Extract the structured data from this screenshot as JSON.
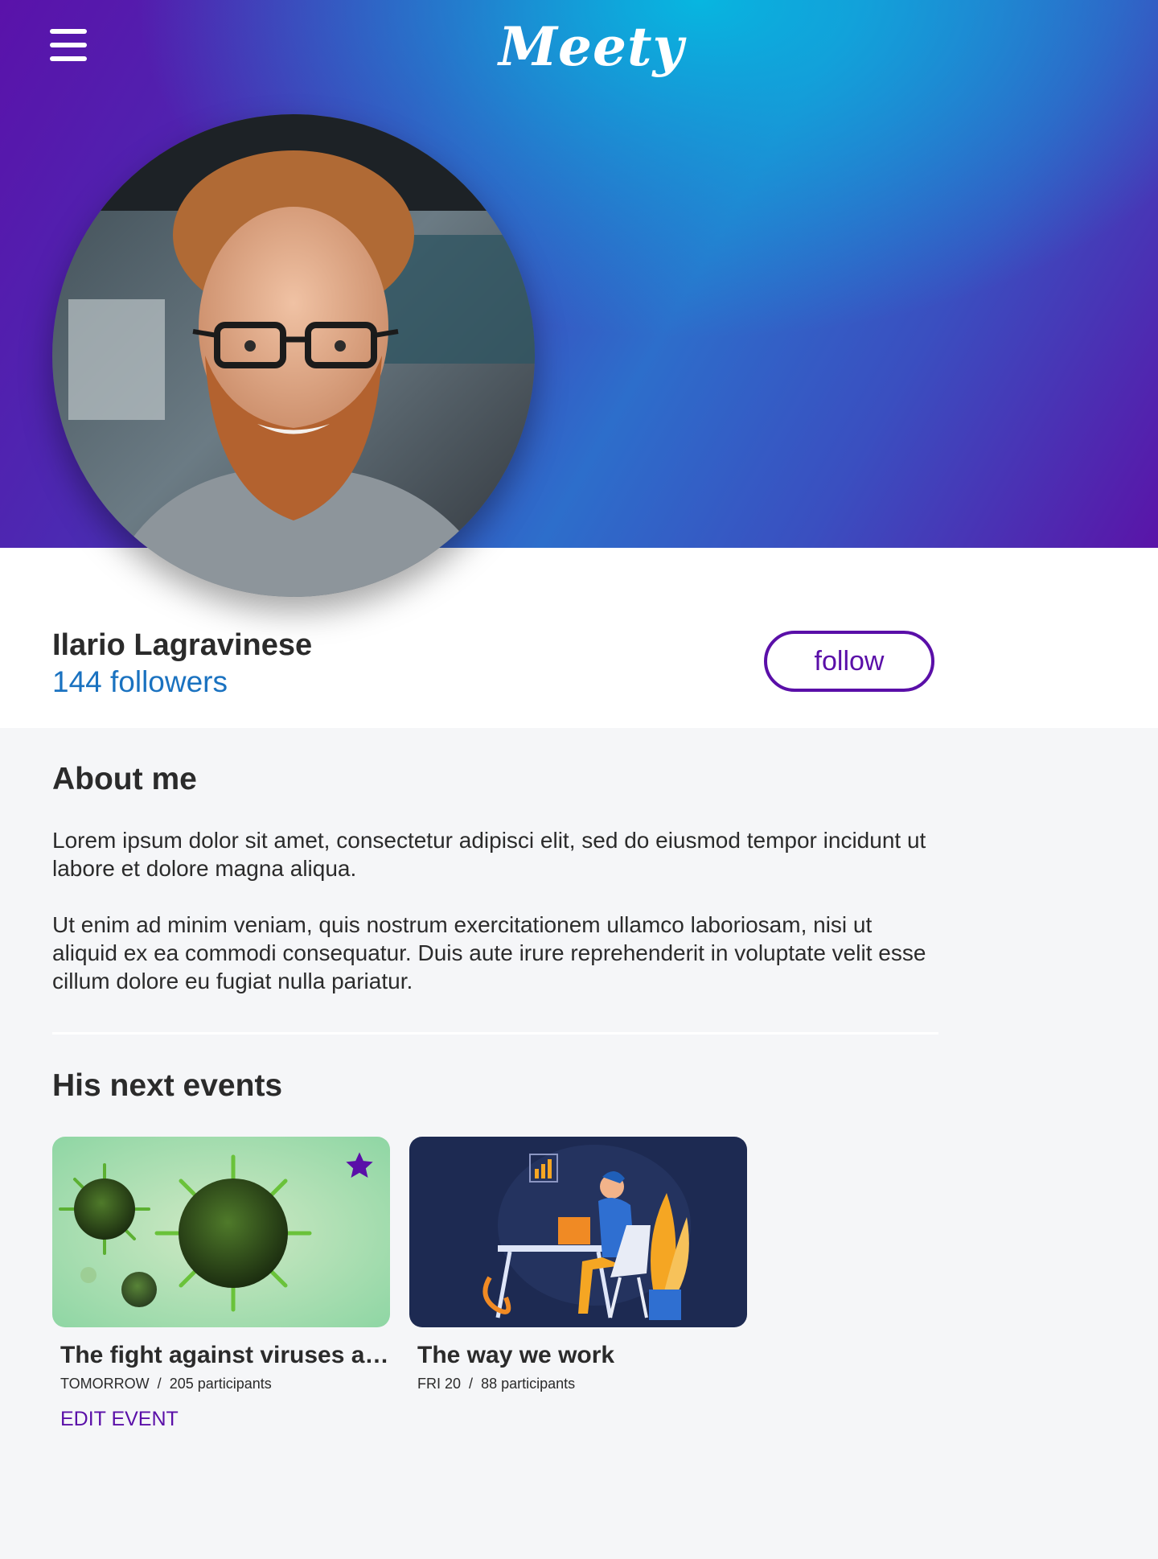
{
  "header": {
    "logo_text": "Meety",
    "menu_icon": "hamburger-menu-icon"
  },
  "profile": {
    "name": "Ilario Lagravinese",
    "followers": "144 followers",
    "follow_label": "follow"
  },
  "about": {
    "title": "About me",
    "paragraphs": [
      "Lorem ipsum dolor sit amet, consectetur adipisci elit, sed do eiusmod tempor incidunt ut labore et dolore magna aliqua.",
      "Ut enim ad minim veniam, quis nostrum exercitationem ullamco laboriosam, nisi ut aliquid ex ea commodi consequatur. Duis aute irure reprehenderit in voluptate velit esse cillum dolore eu fugiat nulla pariatur."
    ]
  },
  "events": {
    "title": "His next events",
    "items": [
      {
        "title": "The fight against viruses and bacteria",
        "when": "TOMORROW",
        "separator": "/",
        "participants": "205 participants",
        "favorite_icon": "star-icon",
        "edit_label": "EDIT EVENT"
      },
      {
        "title": "The way we work",
        "when": "FRI 20",
        "separator": "/",
        "participants": "88 participants"
      }
    ]
  },
  "colors": {
    "accent": "#5a0fa8",
    "link": "#1a72c0",
    "hero_gradient_start": "#5a12aa",
    "hero_gradient_mid": "#07b6e0"
  }
}
